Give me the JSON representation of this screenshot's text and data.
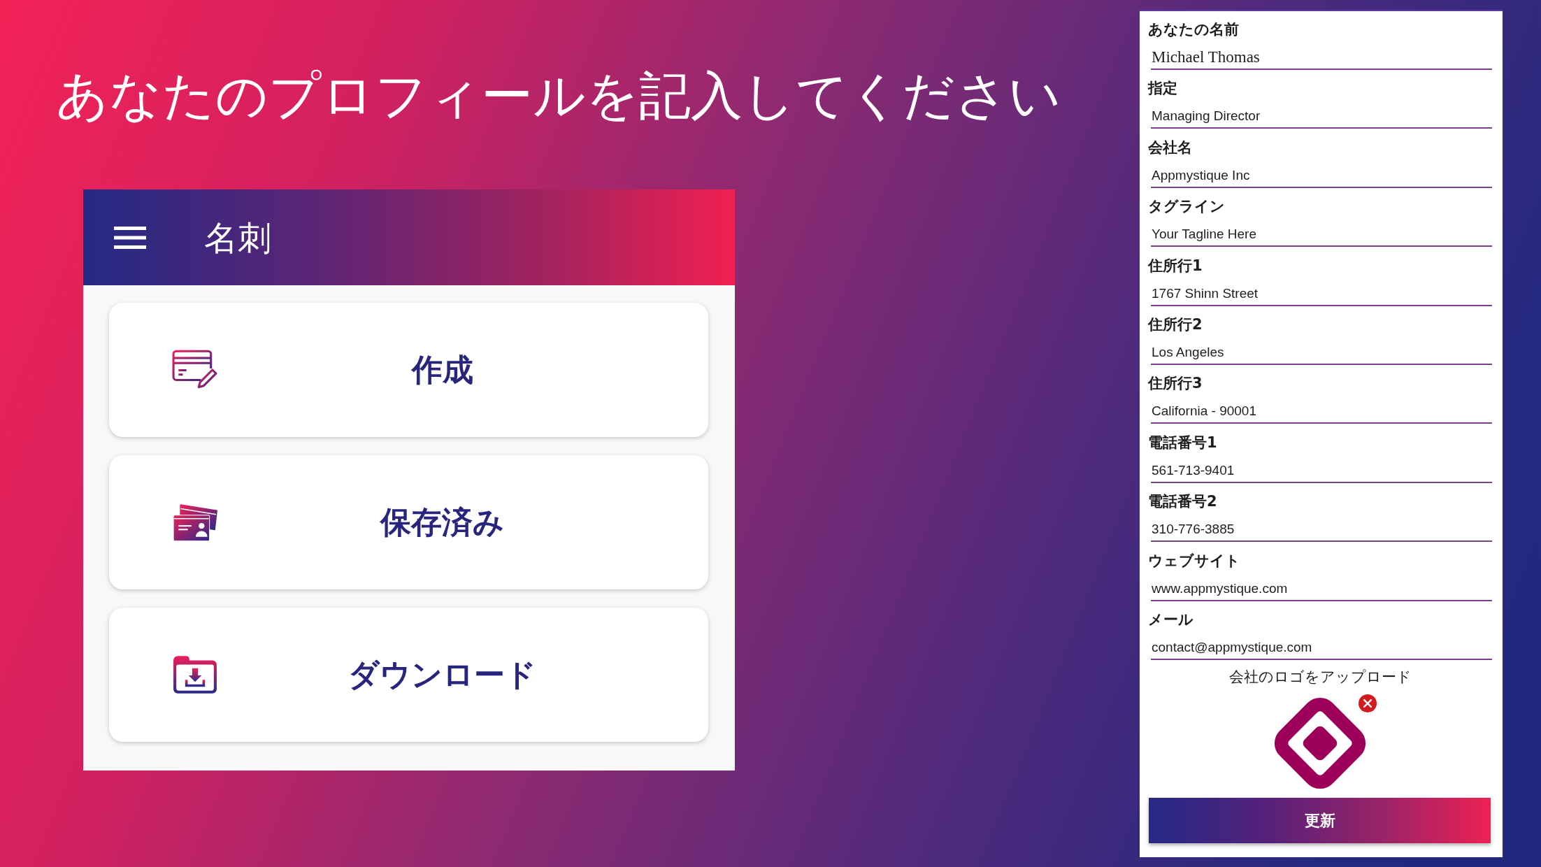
{
  "title": "あなたのプロフィールを記入してください",
  "app": {
    "header": {
      "title": "名刺"
    },
    "menu": [
      {
        "label": "作成"
      },
      {
        "label": "保存済み"
      },
      {
        "label": "ダウンロード"
      }
    ]
  },
  "form": {
    "fields": [
      {
        "label": "あなたの名前",
        "value": "Michael Thomas"
      },
      {
        "label": "指定",
        "value": "Managing Director"
      },
      {
        "label": "会社名",
        "value": "Appmystique Inc"
      },
      {
        "label": "タグライン",
        "value": "Your Tagline Here"
      },
      {
        "label": "住所行1",
        "value": "1767 Shinn Street"
      },
      {
        "label": "住所行2",
        "value": "Los Angeles"
      },
      {
        "label": "住所行3",
        "value": "California - 90001"
      },
      {
        "label": "電話番号1",
        "value": "561-713-9401"
      },
      {
        "label": "電話番号2",
        "value": "310-776-3885"
      },
      {
        "label": "ウェブサイト",
        "value": "www.appmystique.com"
      },
      {
        "label": "メール",
        "value": "contact@appmystique.com"
      }
    ],
    "logo_upload": {
      "label": "会社のロゴをアップロード"
    },
    "submit": "更新"
  }
}
